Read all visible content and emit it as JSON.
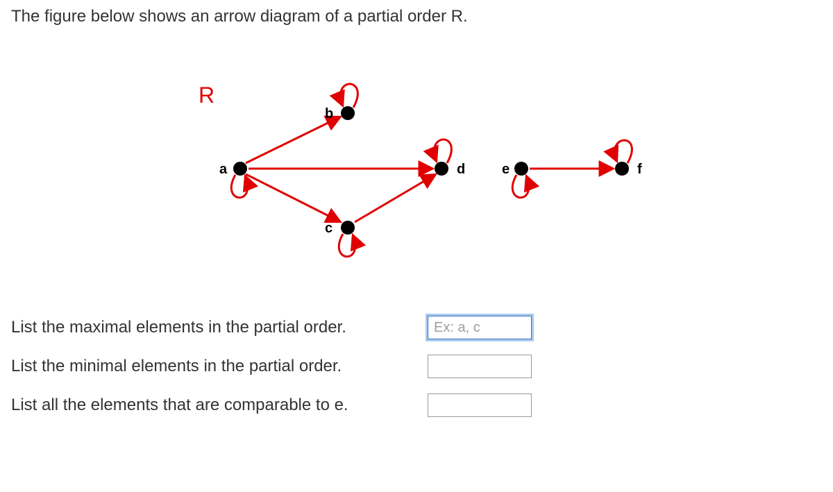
{
  "intro": "The figure below shows an arrow diagram of a partial order R.",
  "relation_label": "R",
  "nodes": {
    "a": "a",
    "b": "b",
    "c": "c",
    "d": "d",
    "e": "e",
    "f": "f"
  },
  "questions": {
    "q1": {
      "text": "List the maximal elements in the partial order.",
      "placeholder": "Ex: a, c",
      "value": ""
    },
    "q2": {
      "text": "List the minimal elements in the partial order.",
      "placeholder": "",
      "value": ""
    },
    "q3": {
      "text": "List all the elements that are comparable to e.",
      "placeholder": "",
      "value": ""
    }
  },
  "chart_data": {
    "type": "directed_graph",
    "title": "Partial order R arrow diagram",
    "vertices": [
      "a",
      "b",
      "c",
      "d",
      "e",
      "f"
    ],
    "self_loops": [
      "a",
      "b",
      "c",
      "d",
      "e",
      "f"
    ],
    "edges": [
      {
        "from": "a",
        "to": "b"
      },
      {
        "from": "a",
        "to": "c"
      },
      {
        "from": "a",
        "to": "d"
      },
      {
        "from": "c",
        "to": "d"
      },
      {
        "from": "e",
        "to": "f"
      }
    ]
  }
}
